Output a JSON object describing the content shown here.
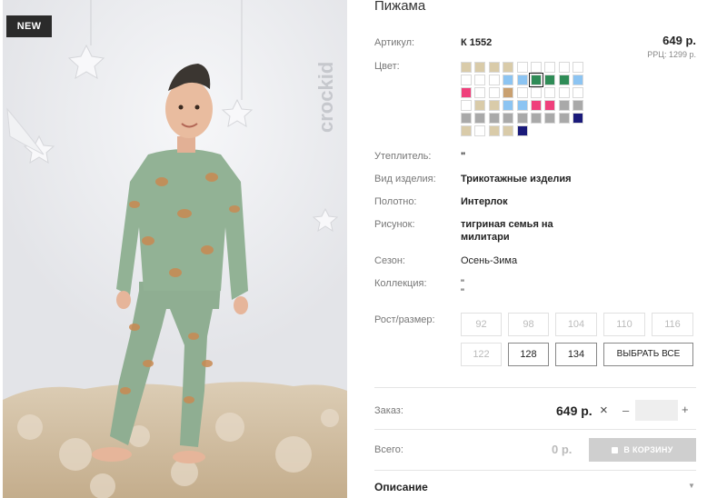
{
  "badge": "NEW",
  "photo": {
    "watermark": "crockid"
  },
  "product": {
    "title": "Пижама",
    "article_label": "Артикул:",
    "article": "К 1552",
    "price": "649 р.",
    "rrc": "РРЦ: 1299 р."
  },
  "color": {
    "label": "Цвет:",
    "swatches": [
      "#d9cba9",
      "#d9cba9",
      "#d9cba9",
      "#d9cba9",
      "#ffffff",
      "#ffffff",
      "#ffffff",
      "#ffffff",
      "#ffffff",
      "#ffffff",
      "#ffffff",
      "#ffffff",
      "#8cc4f2",
      "#8cc4f2",
      "#2f8c57",
      "#2f8c57",
      "#2f8c57",
      "#8cc4f2",
      "#ef3f7b",
      "#ffffff",
      "#ffffff",
      "#c9a070",
      "#ffffff",
      "#ffffff",
      "#ffffff",
      "#ffffff",
      "#ffffff",
      "#ffffff",
      "#d9cba9",
      "#d9cba9",
      "#8cc4f2",
      "#8cc4f2",
      "#ef3f7b",
      "#ef3f7b",
      "#a9a9a9",
      "#a9a9a9",
      "#a9a9a9",
      "#a9a9a9",
      "#a9a9a9",
      "#a9a9a9",
      "#a9a9a9",
      "#a9a9a9",
      "#a9a9a9",
      "#a9a9a9",
      "#1a1a7a",
      "#d9cba9",
      "#ffffff",
      "#d9cba9",
      "#d9cba9",
      "#1a1a7a"
    ],
    "selected_index": 14
  },
  "specs": {
    "insulation_label": "Утеплитель:",
    "insulation": "\"",
    "type_label": "Вид изделия:",
    "type": "Трикотажные изделия",
    "fabric_label": "Полотно:",
    "fabric": "Интерлок",
    "pattern_label": "Рисунок:",
    "pattern_line1": "тигриная семья на",
    "pattern_line2": "милитари",
    "season_label": "Сезон:",
    "season": "Осень-Зима",
    "collection_label": "Коллекция:",
    "collection_line1": "\"",
    "collection_line2": "\""
  },
  "sizes": {
    "label": "Рост/размер:",
    "options": [
      "92",
      "98",
      "104",
      "110",
      "116",
      "122",
      "128",
      "134"
    ],
    "available": [
      "128",
      "134"
    ],
    "select_all": "ВЫБРАТЬ ВСЕ"
  },
  "order": {
    "label": "Заказ:",
    "price": "649 р.",
    "times": "×",
    "minus": "–",
    "plus": "+",
    "quantity": ""
  },
  "total": {
    "label": "Всего:",
    "value": "0 р.",
    "cart_button": "В КОРЗИНУ"
  },
  "description": {
    "label": "Описание",
    "chevron": "▼"
  }
}
